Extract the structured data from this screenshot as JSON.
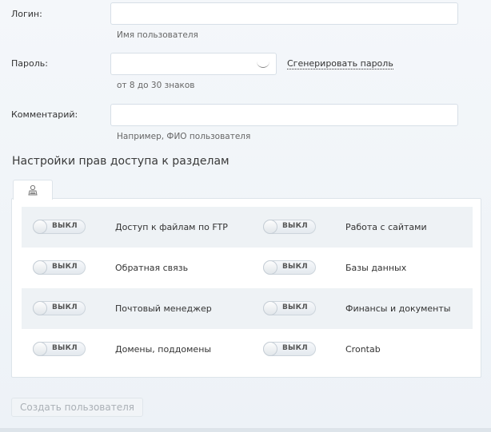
{
  "form": {
    "login": {
      "label": "Логин:",
      "value": "",
      "hint": "Имя пользователя"
    },
    "password": {
      "label": "Пароль:",
      "value": "",
      "hint": "от 8 до 30 знаков",
      "generate_link": "Сгенерировать пароль"
    },
    "comment": {
      "label": "Комментарий:",
      "value": "",
      "hint": "Например, ФИО пользователя"
    }
  },
  "access": {
    "title": "Настройки прав доступа к разделам",
    "tab_icon": "user-icon",
    "toggle_off_label": "ВЫКЛ",
    "rows": [
      {
        "left": "Доступ к файлам по FTP",
        "right": "Работа с сайтами"
      },
      {
        "left": "Обратная связь",
        "right": "Базы данных"
      },
      {
        "left": "Почтовый менеджер",
        "right": "Финансы и документы"
      },
      {
        "left": "Домены, поддомены",
        "right": "Crontab"
      }
    ]
  },
  "create_button": "Создать пользователя"
}
